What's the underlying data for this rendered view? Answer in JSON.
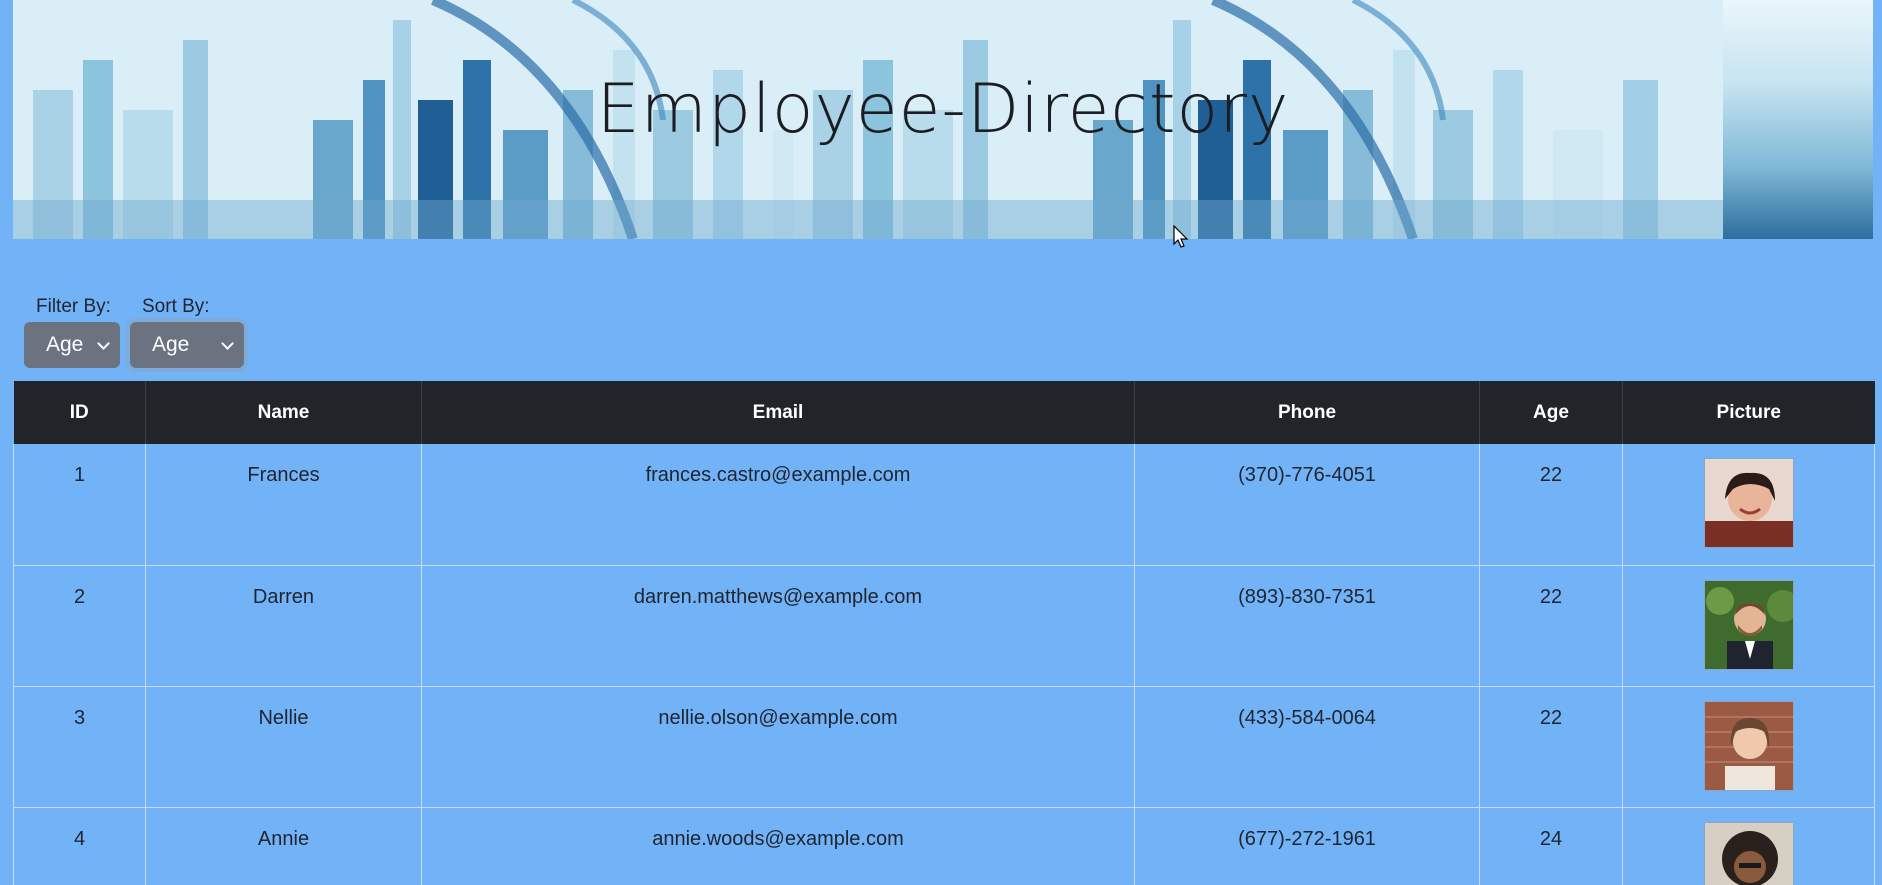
{
  "header": {
    "title": "Employee-Directory"
  },
  "controls": {
    "filter_label": "Filter By:",
    "filter_value": "Age",
    "sort_label": "Sort By:",
    "sort_value": "Age"
  },
  "table": {
    "columns": [
      "ID",
      "Name",
      "Email",
      "Phone",
      "Age",
      "Picture"
    ],
    "rows": [
      {
        "id": "1",
        "name": "Frances",
        "email": "frances.castro@example.com",
        "phone": "(370)-776-4051",
        "age": "22"
      },
      {
        "id": "2",
        "name": "Darren",
        "email": "darren.matthews@example.com",
        "phone": "(893)-830-7351",
        "age": "22"
      },
      {
        "id": "3",
        "name": "Nellie",
        "email": "nellie.olson@example.com",
        "phone": "(433)-584-0064",
        "age": "22"
      },
      {
        "id": "4",
        "name": "Annie",
        "email": "annie.woods@example.com",
        "phone": "(677)-272-1961",
        "age": "24"
      }
    ]
  },
  "colors": {
    "page_background": "#72b3f7",
    "table_header": "#212529",
    "select_background": "#6b7380"
  }
}
